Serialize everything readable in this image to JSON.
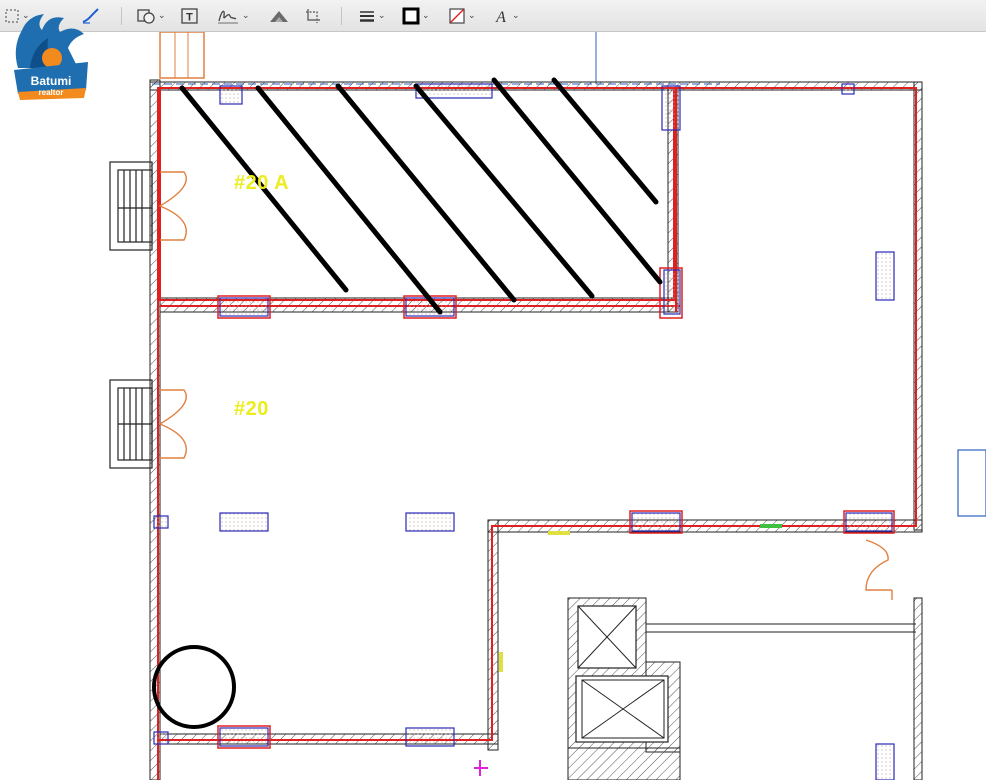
{
  "toolbar": {
    "tools": [
      {
        "name": "selection",
        "icon": "dashed-rect-select-icon",
        "has_menu": true
      },
      {
        "name": "sketch",
        "icon": "pen-sketch-icon",
        "has_menu": false
      },
      {
        "name": "shapes",
        "icon": "shapes-icon",
        "has_menu": true
      },
      {
        "name": "text",
        "icon": "text-box-icon",
        "has_menu": false
      },
      {
        "name": "sign",
        "icon": "signature-icon",
        "has_menu": true
      },
      {
        "name": "adjust-color",
        "icon": "adjust-color-icon",
        "has_menu": false
      },
      {
        "name": "crop",
        "icon": "crop-icon",
        "has_menu": false
      },
      {
        "name": "shape-style",
        "icon": "line-style-icon",
        "has_menu": true
      },
      {
        "name": "border-color",
        "icon": "border-color-icon",
        "has_menu": true
      },
      {
        "name": "fill-color",
        "icon": "fill-color-icon",
        "has_menu": true
      },
      {
        "name": "text-style",
        "icon": "text-style-icon",
        "has_menu": true
      }
    ],
    "text_tool_glyph": "T",
    "text_style_glyph": "A"
  },
  "logo": {
    "line1": "Batumi",
    "line2": "realtor"
  },
  "rooms": [
    {
      "label": "#20 A"
    },
    {
      "label": "#20"
    }
  ],
  "colors": {
    "wall_outline": "#e02020",
    "wall_hatch": "#555555",
    "room_label": "#ecec1e",
    "markup_ink": "#000000",
    "door": "#e08040",
    "column": "#2a2ab8"
  }
}
